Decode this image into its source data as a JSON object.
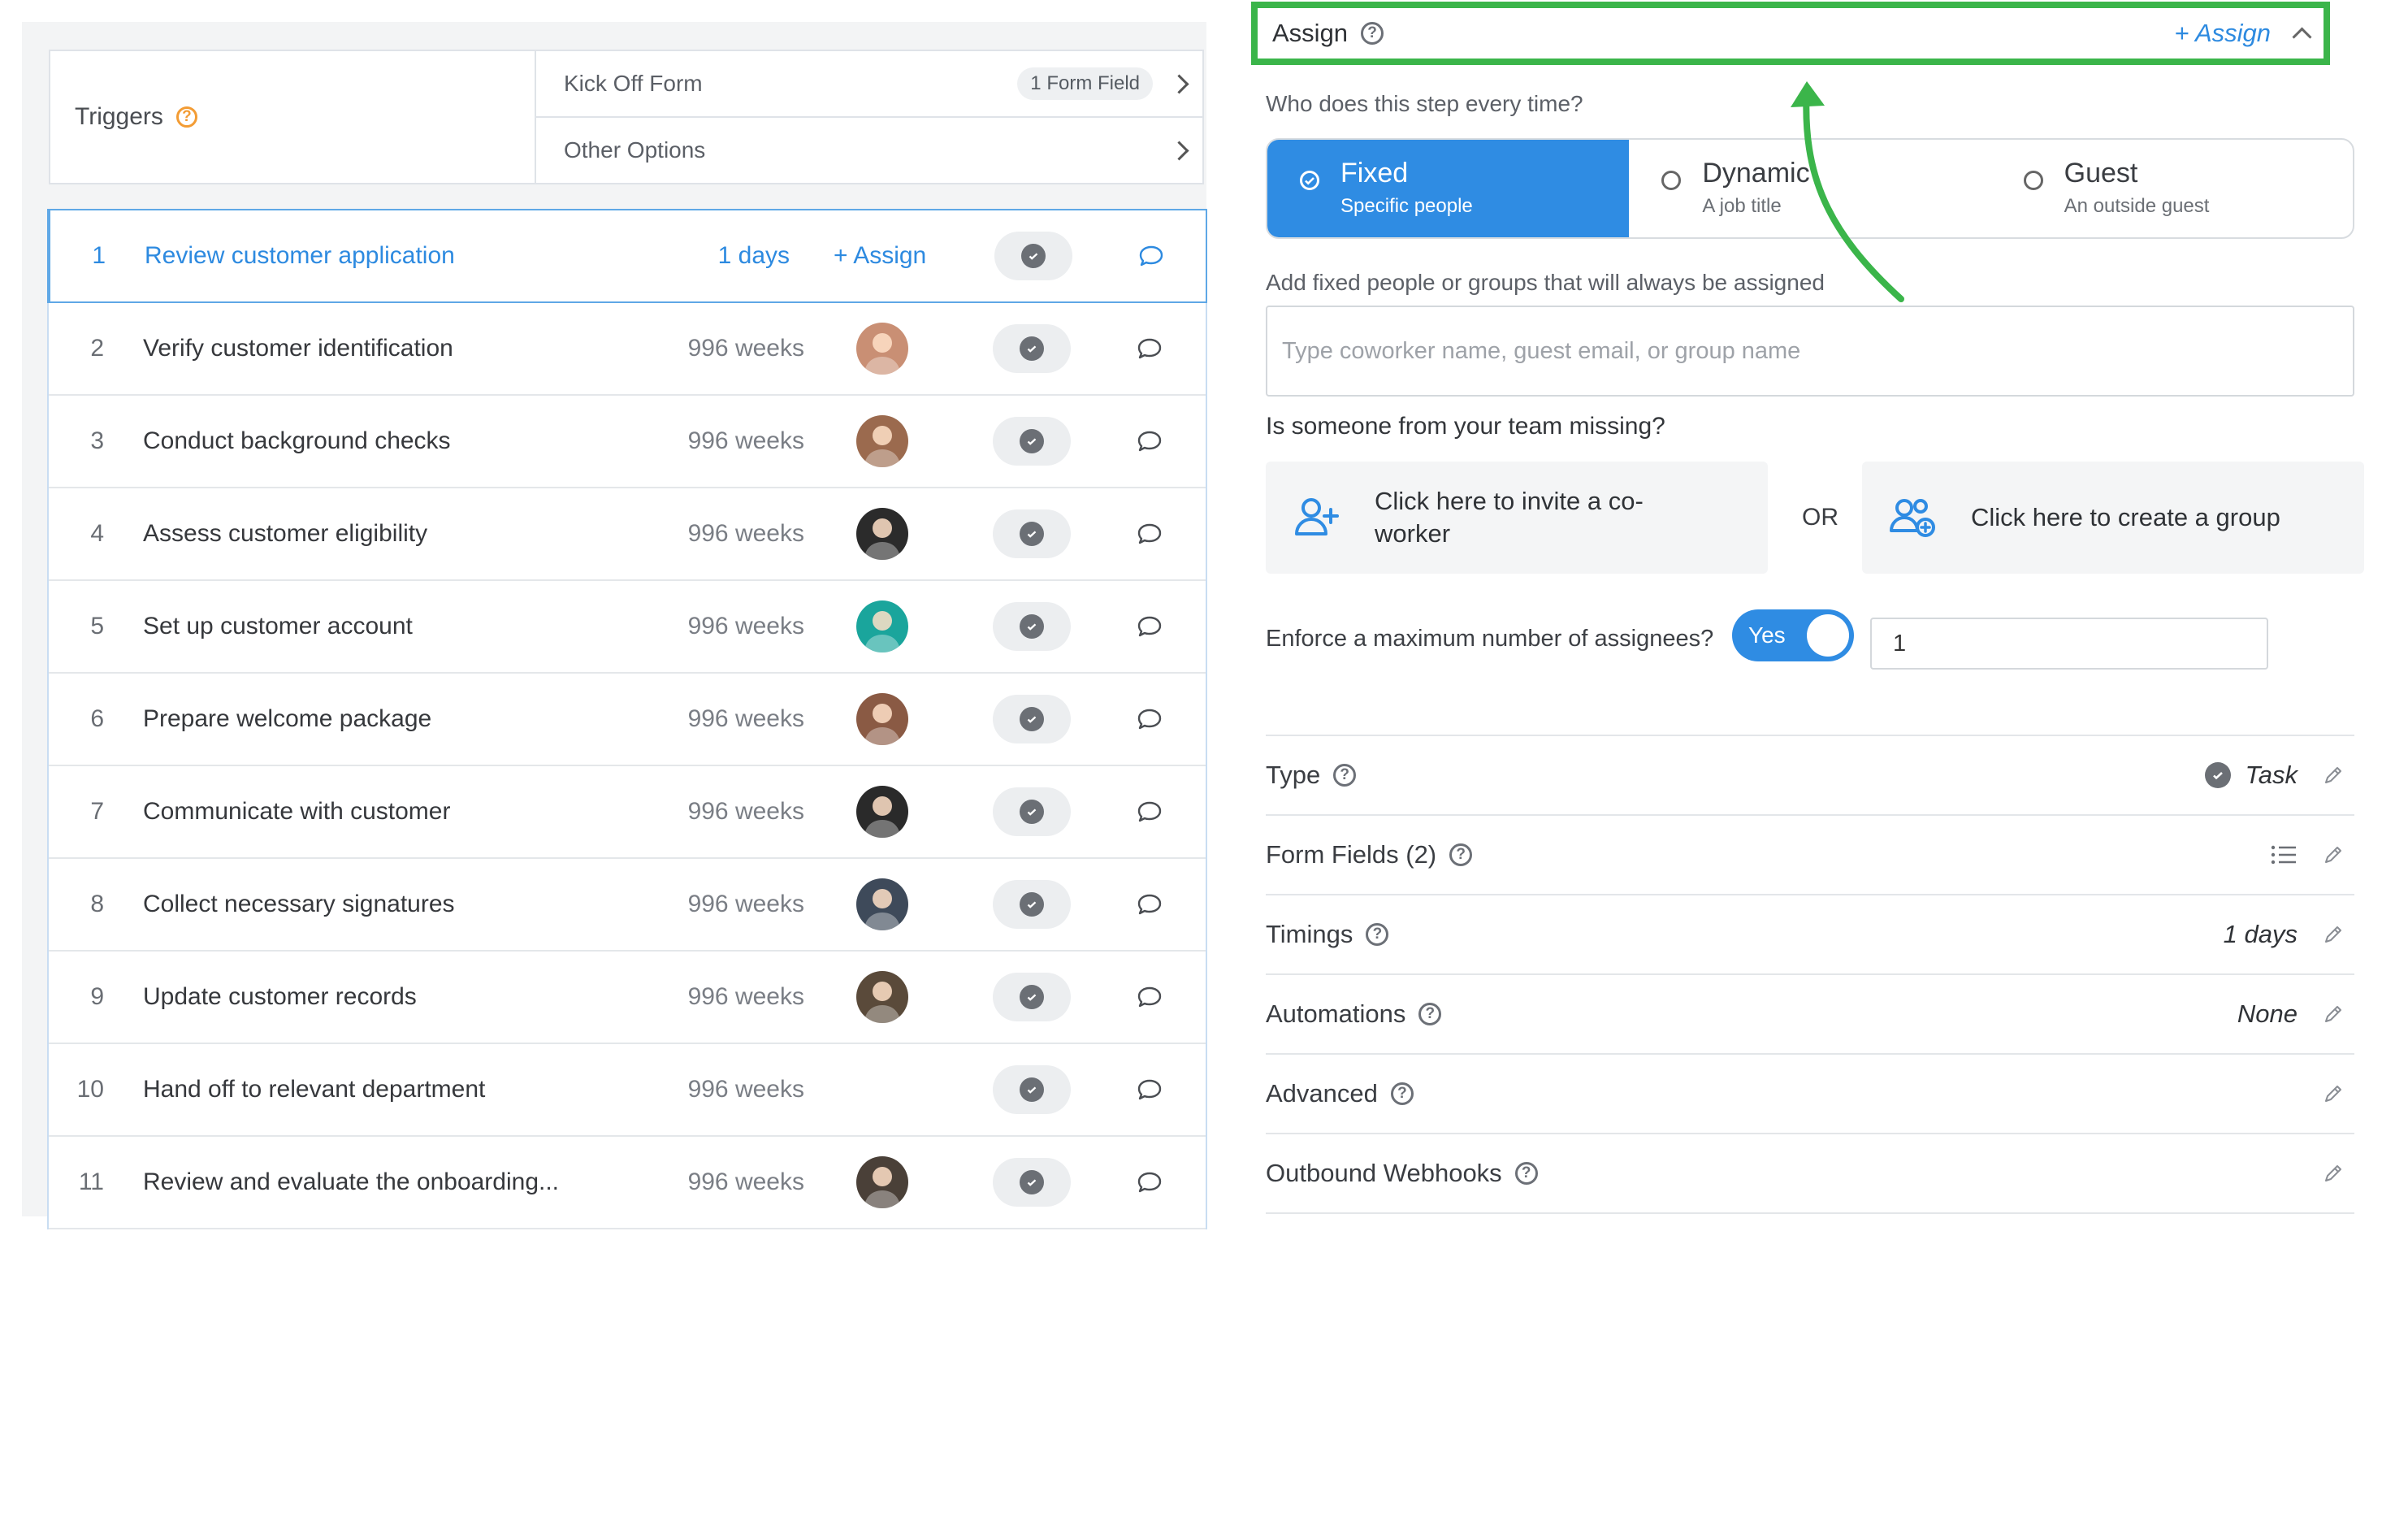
{
  "triggers": {
    "label": "Triggers",
    "kickoff_label": "Kick Off Form",
    "kickoff_badge": "1 Form Field",
    "other_options_label": "Other Options"
  },
  "steps": [
    {
      "num": "1",
      "title": "Review customer application",
      "due": "1 days",
      "assign": "+ Assign",
      "active": true
    },
    {
      "num": "2",
      "title": "Verify customer identification",
      "due": "996 weeks"
    },
    {
      "num": "3",
      "title": "Conduct background checks",
      "due": "996 weeks"
    },
    {
      "num": "4",
      "title": "Assess customer eligibility",
      "due": "996 weeks"
    },
    {
      "num": "5",
      "title": "Set up customer account",
      "due": "996 weeks"
    },
    {
      "num": "6",
      "title": "Prepare welcome package",
      "due": "996 weeks"
    },
    {
      "num": "7",
      "title": "Communicate with customer",
      "due": "996 weeks"
    },
    {
      "num": "8",
      "title": "Collect necessary signatures",
      "due": "996 weeks"
    },
    {
      "num": "9",
      "title": "Update customer records",
      "due": "996 weeks"
    },
    {
      "num": "10",
      "title": "Hand off to relevant department",
      "due": "996 weeks"
    },
    {
      "num": "11",
      "title": "Review and evaluate the onboarding...",
      "due": "996 weeks"
    }
  ],
  "assign_panel": {
    "header_label": "Assign",
    "header_link": "+ Assign",
    "who_question": "Who does this step every time?",
    "options": [
      {
        "title": "Fixed",
        "subtitle": "Specific people",
        "selected": true
      },
      {
        "title": "Dynamic",
        "subtitle": "A job title",
        "selected": false
      },
      {
        "title": "Guest",
        "subtitle": "An outside guest",
        "selected": false
      }
    ],
    "add_fixed_label": "Add fixed people or groups that will always be assigned",
    "coworker_placeholder": "Type coworker name, guest email, or group name",
    "missing_question": "Is someone from your team missing?",
    "invite_label": "Click here to invite a co-worker",
    "or_label": "OR",
    "create_group_label": "Click here to create a group",
    "enforce_label": "Enforce a maximum number of assignees?",
    "toggle_label": "Yes",
    "max_assignees_value": "1"
  },
  "properties": {
    "type_label": "Type",
    "type_value": "Task",
    "form_fields_label": "Form Fields (2)",
    "timings_label": "Timings",
    "timings_value": "1 days",
    "automations_label": "Automations",
    "automations_value": "None",
    "advanced_label": "Advanced",
    "webhooks_label": "Outbound Webhooks"
  },
  "colors": {
    "accent": "#2f8ce3",
    "highlight_frame": "#3bb54a",
    "trigger_help": "#f39c34"
  }
}
